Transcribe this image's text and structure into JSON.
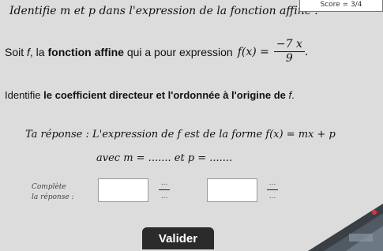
{
  "header": {
    "title": "Identifie m et p dans l'expression de la fonction affine :",
    "score": "Score = 3/4"
  },
  "question": {
    "intro_prefix": "Soit",
    "intro_f": "f",
    "intro_mid": ", la",
    "intro_bold": "fonction affine",
    "intro_suffix": "qui a pour expression",
    "formula_lhs": "f(x) =",
    "numerator": "−7 x",
    "denominator": "9",
    "period": ".",
    "task_prefix": "Identifie",
    "task_bold": "le coefficient directeur et l'ordonnée à l'origine de",
    "task_f": "f",
    "task_suffix": "."
  },
  "answer": {
    "line": "Ta réponse : L'expression de f est de la forme f(x) = mx + p",
    "avec": "avec m = ....... et p = ......."
  },
  "inputs": {
    "label_line1": "Complète",
    "label_line2": "la réponse :",
    "fraction_top": "...",
    "fraction_bottom": "..."
  },
  "actions": {
    "submit": "Valider"
  }
}
